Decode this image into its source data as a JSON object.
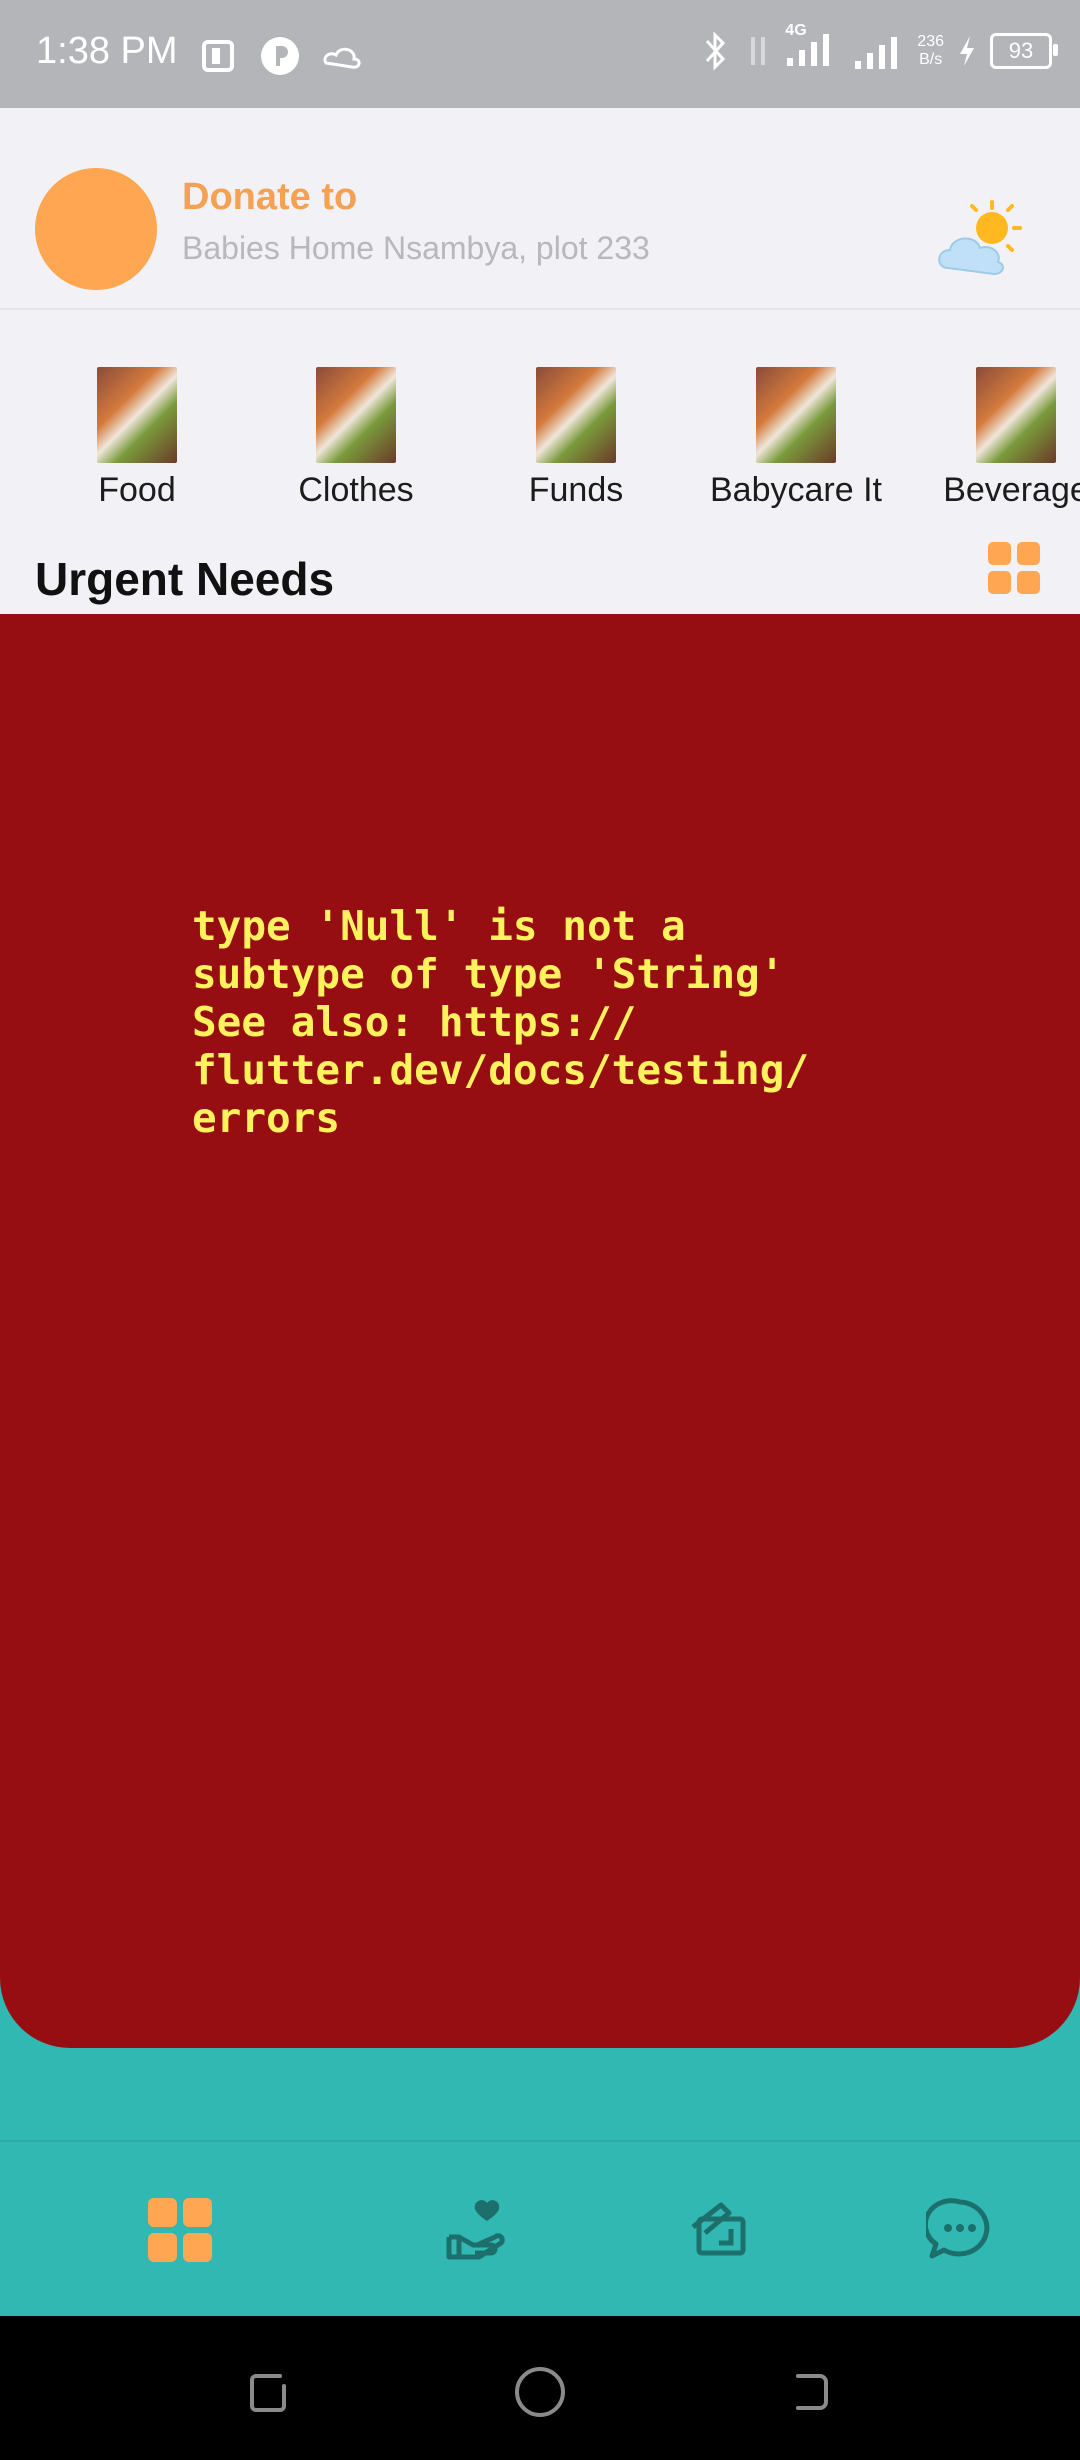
{
  "status_bar": {
    "time": "1:38 PM",
    "network_type": "4G",
    "net_speed_value": "236",
    "net_speed_unit": "B/s",
    "battery": "93"
  },
  "header": {
    "donate_label": "Donate to",
    "location": "Babies Home Nsambya, plot 233",
    "weather_icon": "partly-sunny-icon"
  },
  "categories": [
    {
      "label": "Food"
    },
    {
      "label": "Clothes"
    },
    {
      "label": "Funds"
    },
    {
      "label": "Babycare It"
    },
    {
      "label": "Beverage"
    }
  ],
  "section": {
    "title": "Urgent Needs"
  },
  "error": {
    "message": "type 'Null' is not a\nsubtype of type 'String'\nSee also: https://\nflutter.dev/docs/testing/\nerrors"
  },
  "bottom_nav": [
    {
      "icon": "grid-home-icon"
    },
    {
      "icon": "donate-hand-heart-icon"
    },
    {
      "icon": "document-edit-icon"
    },
    {
      "icon": "chat-bubble-icon"
    }
  ],
  "colors": {
    "accent_orange": "#ffa652",
    "teal": "#32b8b3",
    "error_red": "#960e11",
    "error_text": "#fff25e"
  }
}
